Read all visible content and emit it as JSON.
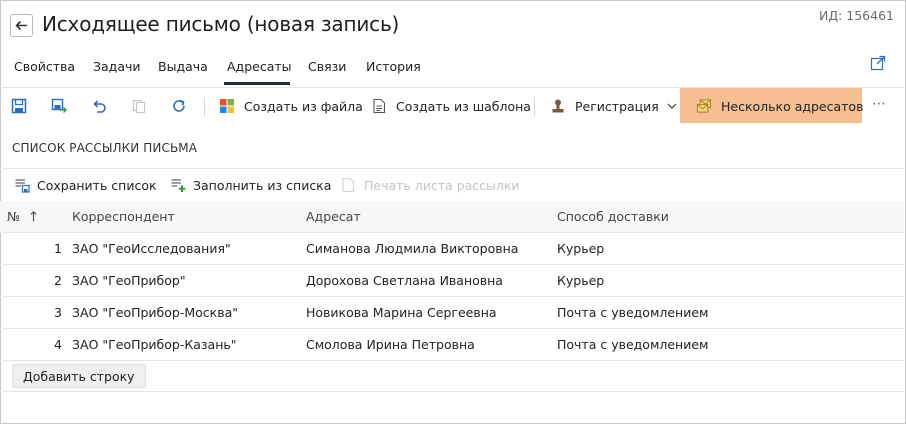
{
  "window": {
    "title": "Исходящее письмо (новая запись)",
    "id_label": "ИД: 156461"
  },
  "tabs": [
    {
      "label": "Свойства",
      "active": false
    },
    {
      "label": "Задачи",
      "active": false
    },
    {
      "label": "Выдача",
      "active": false
    },
    {
      "label": "Адресаты",
      "active": true
    },
    {
      "label": "Связи",
      "active": false
    },
    {
      "label": "История",
      "active": false
    }
  ],
  "toolbar": {
    "icons": [
      "save-icon",
      "save-to-icon",
      "undo-icon",
      "copy-icon",
      "refresh-icon"
    ],
    "create_from_file": "Создать из файла",
    "create_from_template": "Создать из шаблона",
    "registration": "Регистрация",
    "multiple_recipients": "Несколько адресатов",
    "more": "⋯"
  },
  "section": {
    "title": "СПИСОК РАССЫЛКИ ПИСЬМА"
  },
  "subtoolbar": {
    "save_list": "Сохранить список",
    "fill_from_list": "Заполнить из списка",
    "print_list": "Печать листа рассылки"
  },
  "table": {
    "columns": [
      "№",
      "Корреспондент",
      "Адресат",
      "Способ доставки"
    ],
    "rows": [
      {
        "num": "1",
        "correspondent": "ЗАО \"ГеоИсследования\"",
        "addressee": "Симанова Людмила Викторовна",
        "delivery": "Курьер"
      },
      {
        "num": "2",
        "correspondent": "ЗАО \"ГеоПрибор\"",
        "addressee": "Дорохова Светлана Ивановна",
        "delivery": "Курьер"
      },
      {
        "num": "3",
        "correspondent": "ЗАО \"ГеоПрибор-Москва\"",
        "addressee": "Новикова Марина Сергеевна",
        "delivery": "Почта с уведомлением"
      },
      {
        "num": "4",
        "correspondent": "ЗАО \"ГеоПрибор-Казань\"",
        "addressee": "Смолова Ирина Петровна",
        "delivery": "Почта с уведомлением"
      }
    ],
    "add_row": "Добавить строку"
  },
  "colors": {
    "accent_highlight": "#f6bf92",
    "icon_blue": "#2c6fb7",
    "tab_underline": "#1f2d3d"
  }
}
